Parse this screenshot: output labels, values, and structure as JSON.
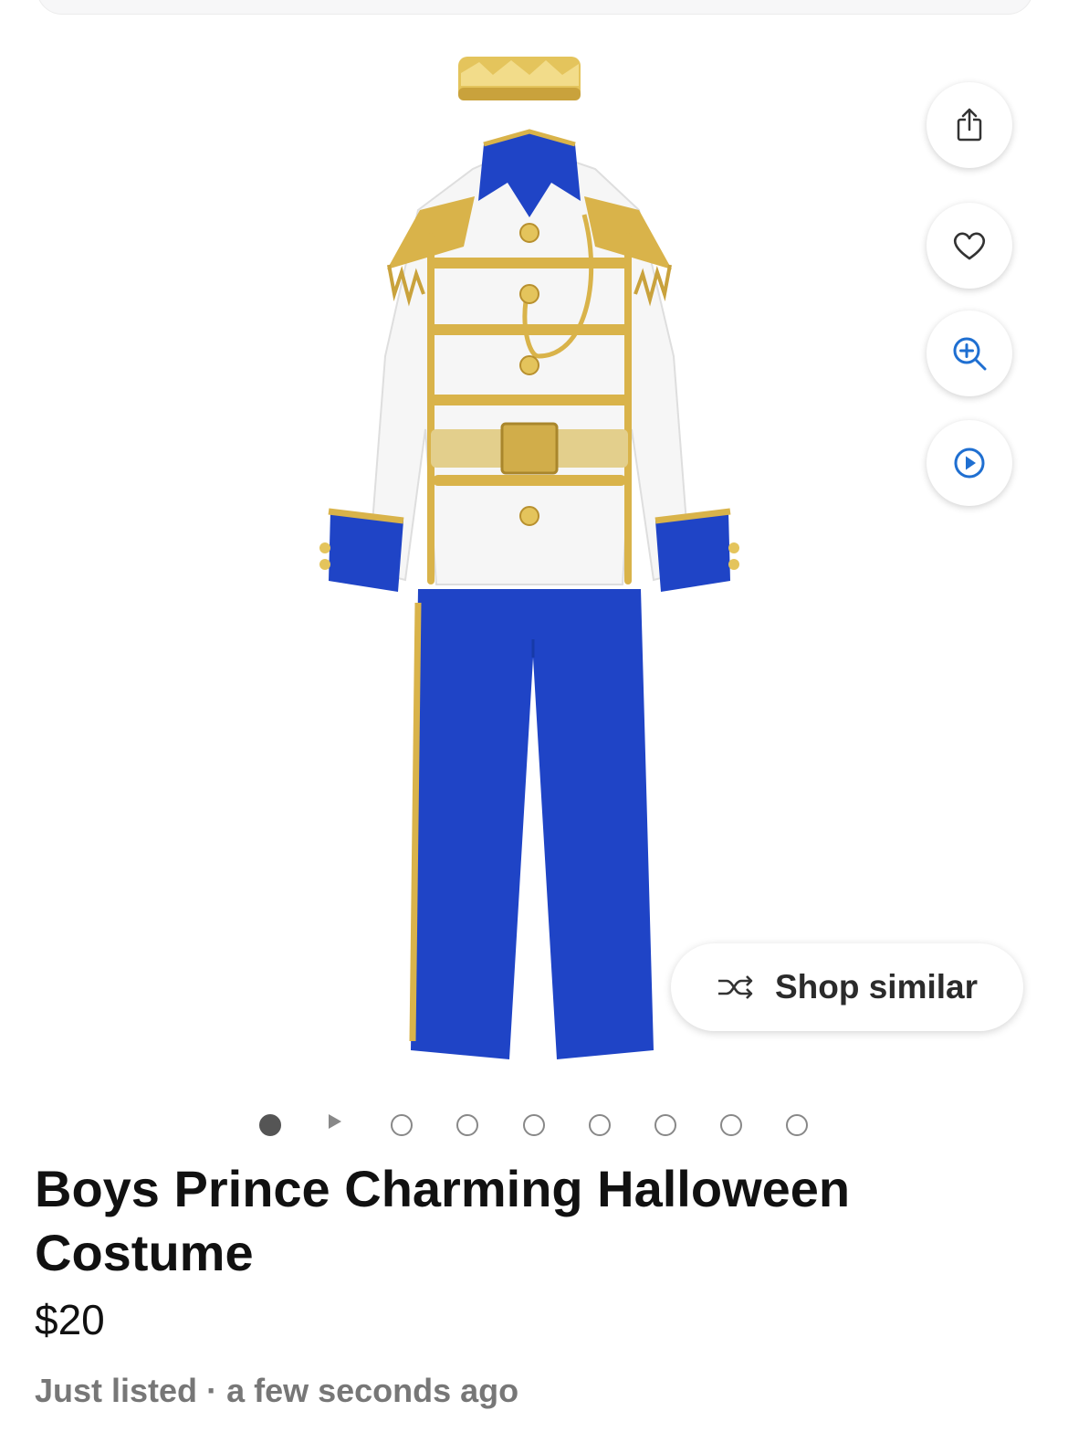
{
  "actions": {
    "share_icon": "share-icon",
    "save_icon": "heart-icon",
    "zoom_icon": "zoom-in-icon",
    "video_icon": "play-icon"
  },
  "shop_similar": {
    "label": "Shop similar",
    "icon": "shuffle-icon"
  },
  "gallery": {
    "image_count": 9,
    "active_index": 0
  },
  "listing": {
    "title": "Boys Prince Charming Halloween Costume",
    "price": "$20",
    "status": "Just listed",
    "separator": " · ",
    "time": "a few seconds ago"
  },
  "colors": {
    "royal_blue": "#1f44c6",
    "gold": "#d9b34a",
    "accent_blue": "#1f6fd1"
  }
}
